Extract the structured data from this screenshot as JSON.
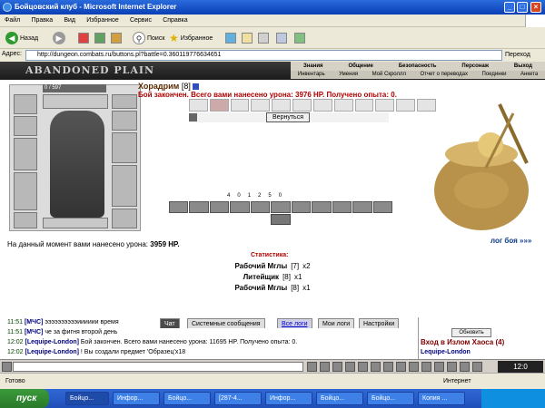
{
  "window": {
    "title": "Бойцовский клуб - Microsoft Internet Explorer"
  },
  "menu": [
    "Файл",
    "Правка",
    "Вид",
    "Избранное",
    "Сервис",
    "Справка"
  ],
  "toolbar": {
    "back": "Назад",
    "search": "Поиск",
    "favorites": "Избранное"
  },
  "address": {
    "label": "Адрес:",
    "url": "http://dungeon.combats.ru/buttons.pl?battle=0.360119776634651",
    "go": "Переход"
  },
  "game": {
    "logo": "ABANDONED PLAIN",
    "nav_top": [
      "Знания",
      "Общение",
      "Безопасность",
      "Персонаж",
      "Выход"
    ],
    "nav_bottom": [
      "Инвентарь",
      "Умения",
      "Мой Скроллл",
      "Отчет о переводах",
      "Поединки",
      "Анкета"
    ],
    "hp_bar": "0 / 597"
  },
  "battle": {
    "char_name": "Хорадрим",
    "char_level": "[8]",
    "result": "Бой закончен. Всего вами нанесено урона: 3976 HP. Получено опыта: 0.",
    "back_button": "Вернуться",
    "counts": [
      "4",
      "0",
      "1",
      "2",
      "5",
      "0"
    ],
    "damage_now": "На данный момент вами нанесено урона: ",
    "damage_value": "3959 HP.",
    "log_link": "лог боя »»»",
    "stats_title": "Статистика:",
    "stats": [
      {
        "name": "Рабочий Мглы",
        "level": "[7]",
        "count": "x2"
      },
      {
        "name": "Литейщик",
        "level": "[8]",
        "count": "x1"
      },
      {
        "name": "Рабочий Мглы",
        "level": "[8]",
        "count": "x1"
      }
    ]
  },
  "chat": {
    "tabs": [
      "Чат",
      "Системные сообщения",
      "Все логи",
      "Мои логи",
      "Настройки"
    ],
    "lines": [
      {
        "time": "11:51",
        "user": "[МЧС]",
        "text": "ээээээээээииииии время"
      },
      {
        "time": "11:51",
        "user": "[МЧС]",
        "text": "че за фигня второй день"
      },
      {
        "time": "12:02",
        "user": "[Lequipe-London]",
        "text": "Бой закончен. Всего вами нанесено урона: 11695 HP. Получено опыта: 0."
      },
      {
        "time": "12:02",
        "user": "[Lequipe-London]",
        "text": "! Вы создали предмет 'Образец'x18"
      }
    ],
    "side_update": "Обновить",
    "side_chaos": "Вход в Излом Хаоса (4)",
    "side_user": "Lequipe-London"
  },
  "status": {
    "left": "Готово",
    "right": "Интернет"
  },
  "taskbar": {
    "start": "пуск",
    "items": [
      "Бойцо...",
      "Инфор...",
      "Бойцо...",
      "[287-4...",
      "Инфор...",
      "Бойцо...",
      "Бойцо...",
      "Копия ..."
    ],
    "clock": "12:0"
  }
}
